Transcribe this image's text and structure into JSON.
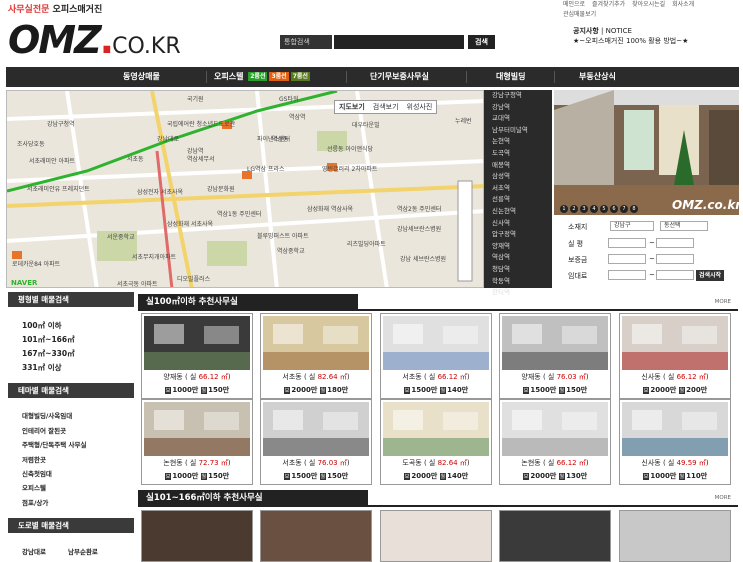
{
  "header": {
    "slogan_a": "사무실전문",
    "slogan_b": "오피스매거진",
    "toplinks": [
      "메인으로",
      "즐겨찾기추가",
      "찾아오시는길",
      "회사소개",
      "관심매물보기"
    ],
    "logo_main": "OMZ",
    "logo_dot": ".",
    "logo_kr": "CO.KR",
    "search_select": "통합검색",
    "search_button": "검색",
    "notice_label": "공지사항",
    "notice_sub": "NOTICE",
    "notice_text": "★~오피스매거진 100% 활용 방법~★"
  },
  "nav": {
    "items": [
      "동영상매물",
      "오피스텔",
      "단기무보증사무실",
      "대형빌딩",
      "부동산상식"
    ],
    "tags": [
      {
        "label": "2룸선",
        "color": "#2aa02a"
      },
      {
        "label": "3룸선",
        "color": "#e06010"
      },
      {
        "label": "7룸선",
        "color": "#5a7a20"
      }
    ]
  },
  "map": {
    "buttons": [
      "지도보기",
      "검색보기",
      "위성사진"
    ],
    "labels": [
      "국기원",
      "GS타워",
      "역삼역",
      "대우타운빌",
      "누레번",
      "역삼동",
      "강남구청역",
      "조사당호동",
      "국립에어란 청소년드도로관",
      "강남역",
      "파이낸스센터",
      "서초동",
      "서초래미안 아파트",
      "선릉동 아이앤식당",
      "LG역삼 프라스",
      "역삼세무서",
      "서초래미안유 프레지던트",
      "삼성전자 서초사옥",
      "강남문화원",
      "영빈갤러리 2차아파트",
      "역삼2동 주민센터",
      "역삼1동 주민센터",
      "서운중학교",
      "삼성화재 서초사옥",
      "블루밍퍼스트 아파트",
      "리츠빌딩아파트",
      "강남세브란스병원",
      "로데카운84 아파트",
      "역삼중학교",
      "서초무지개아파트",
      "디오빌플러스",
      "서초극동 아파트",
      "삼성화재 역삼사옥",
      "강남대로",
      "강남 세브란스병원"
    ],
    "brand": "NAVER"
  },
  "districts": [
    "강남구청역",
    "강남역",
    "교대역",
    "남부터미널역",
    "논현역",
    "도곡역",
    "매봉역",
    "삼성역",
    "서초역",
    "선릉역",
    "신논현역",
    "신사역",
    "압구정역",
    "양재역",
    "역삼역",
    "청담역",
    "학동역",
    "한티역"
  ],
  "photo": {
    "watermark": "OMZ.co.kr",
    "dots": [
      "1",
      "2",
      "3",
      "4",
      "5",
      "6",
      "7",
      "8"
    ]
  },
  "form": {
    "location_label": "소재지",
    "location_value": "강남구",
    "location_value2": "동선택",
    "area_label": "실 평",
    "deposit_label": "보증금",
    "rent_label": "임대료",
    "tilde": "~",
    "search_button": "검색시작"
  },
  "sidebar": {
    "sections": [
      {
        "title": "평형별 매물검색",
        "items": [
          "100㎡ 이하",
          "101㎡~166㎡",
          "167㎡~330㎡",
          "331㎡ 이상"
        ]
      },
      {
        "title": "테마별 매물검색",
        "items": [
          "대형빌딩/사옥임대",
          "인테리어 잘된곳",
          "주택형/단독주택 사무실",
          "저렴한곳",
          "신축첫임대",
          "오피스텔",
          "점포/상가"
        ]
      },
      {
        "title": "도로별 매물검색",
        "items": [
          "강남대로",
          "남부순환로"
        ]
      }
    ]
  },
  "section1": {
    "title": "실100㎡이하 추천사무실",
    "more": "MORE",
    "cards": [
      {
        "loc": "양재동 ( 실 ",
        "area": "66.12 ㎡",
        "dep": "1000만",
        "rent": "150만"
      },
      {
        "loc": "서초동 ( 실 ",
        "area": "82.64 ㎡",
        "dep": "2000만",
        "rent": "180만"
      },
      {
        "loc": "서초동 ( 실 ",
        "area": "66.12 ㎡",
        "dep": "1500만",
        "rent": "140만"
      },
      {
        "loc": "양재동 ( 실 ",
        "area": "76.03 ㎡",
        "dep": "1500만",
        "rent": "150만"
      },
      {
        "loc": "신사동 ( 실 ",
        "area": "66.12 ㎡",
        "dep": "2000만",
        "rent": "200만"
      },
      {
        "loc": "논현동 ( 실 ",
        "area": "72.73 ㎡",
        "dep": "1000만",
        "rent": "150만"
      },
      {
        "loc": "서초동 ( 실 ",
        "area": "76.03 ㎡",
        "dep": "1500만",
        "rent": "150만"
      },
      {
        "loc": "도곡동 ( 실 ",
        "area": "82.64 ㎡",
        "dep": "2000만",
        "rent": "140만"
      },
      {
        "loc": "논현동 ( 실 ",
        "area": "66.12 ㎡",
        "dep": "2000만",
        "rent": "130만"
      },
      {
        "loc": "신사동 ( 실 ",
        "area": "49.59 ㎡",
        "dep": "1000만",
        "rent": "110만"
      }
    ],
    "close": ")",
    "dep_tag": "보",
    "rent_tag": "월"
  },
  "section2": {
    "title": "실101~166㎡이하 추천사무실",
    "more": "MORE"
  }
}
